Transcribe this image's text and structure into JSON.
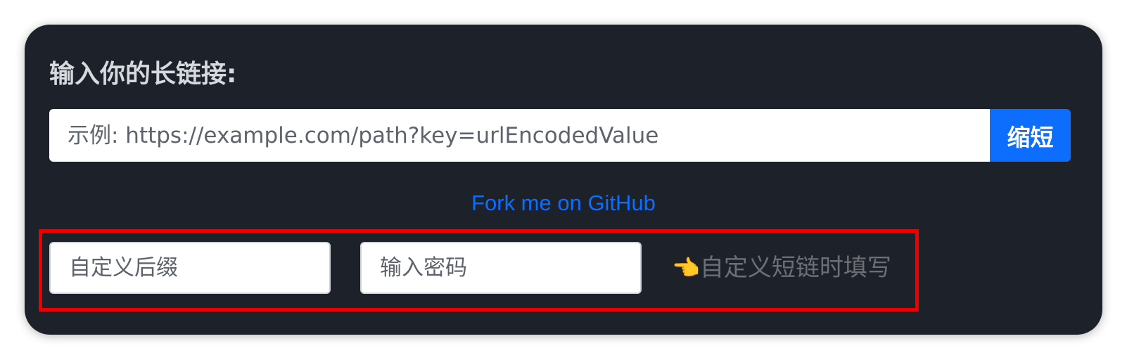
{
  "form": {
    "title": "输入你的长链接:",
    "url_input": {
      "placeholder": "示例: https://example.com/path?key=urlEncodedValue",
      "value": ""
    },
    "shorten_button_label": "缩短"
  },
  "github_link": {
    "label": "Fork me on GitHub"
  },
  "custom": {
    "suffix_input": {
      "placeholder": "自定义后缀",
      "value": ""
    },
    "password_input": {
      "placeholder": "输入密码",
      "value": ""
    },
    "hint": {
      "icon": "pointing-hand-icon",
      "text": "自定义短链时填写"
    }
  },
  "colors": {
    "card_background": "#1d212a",
    "primary": "#0d6efd",
    "highlight_border": "#ee0000",
    "hint_text": "#6c6f74"
  }
}
